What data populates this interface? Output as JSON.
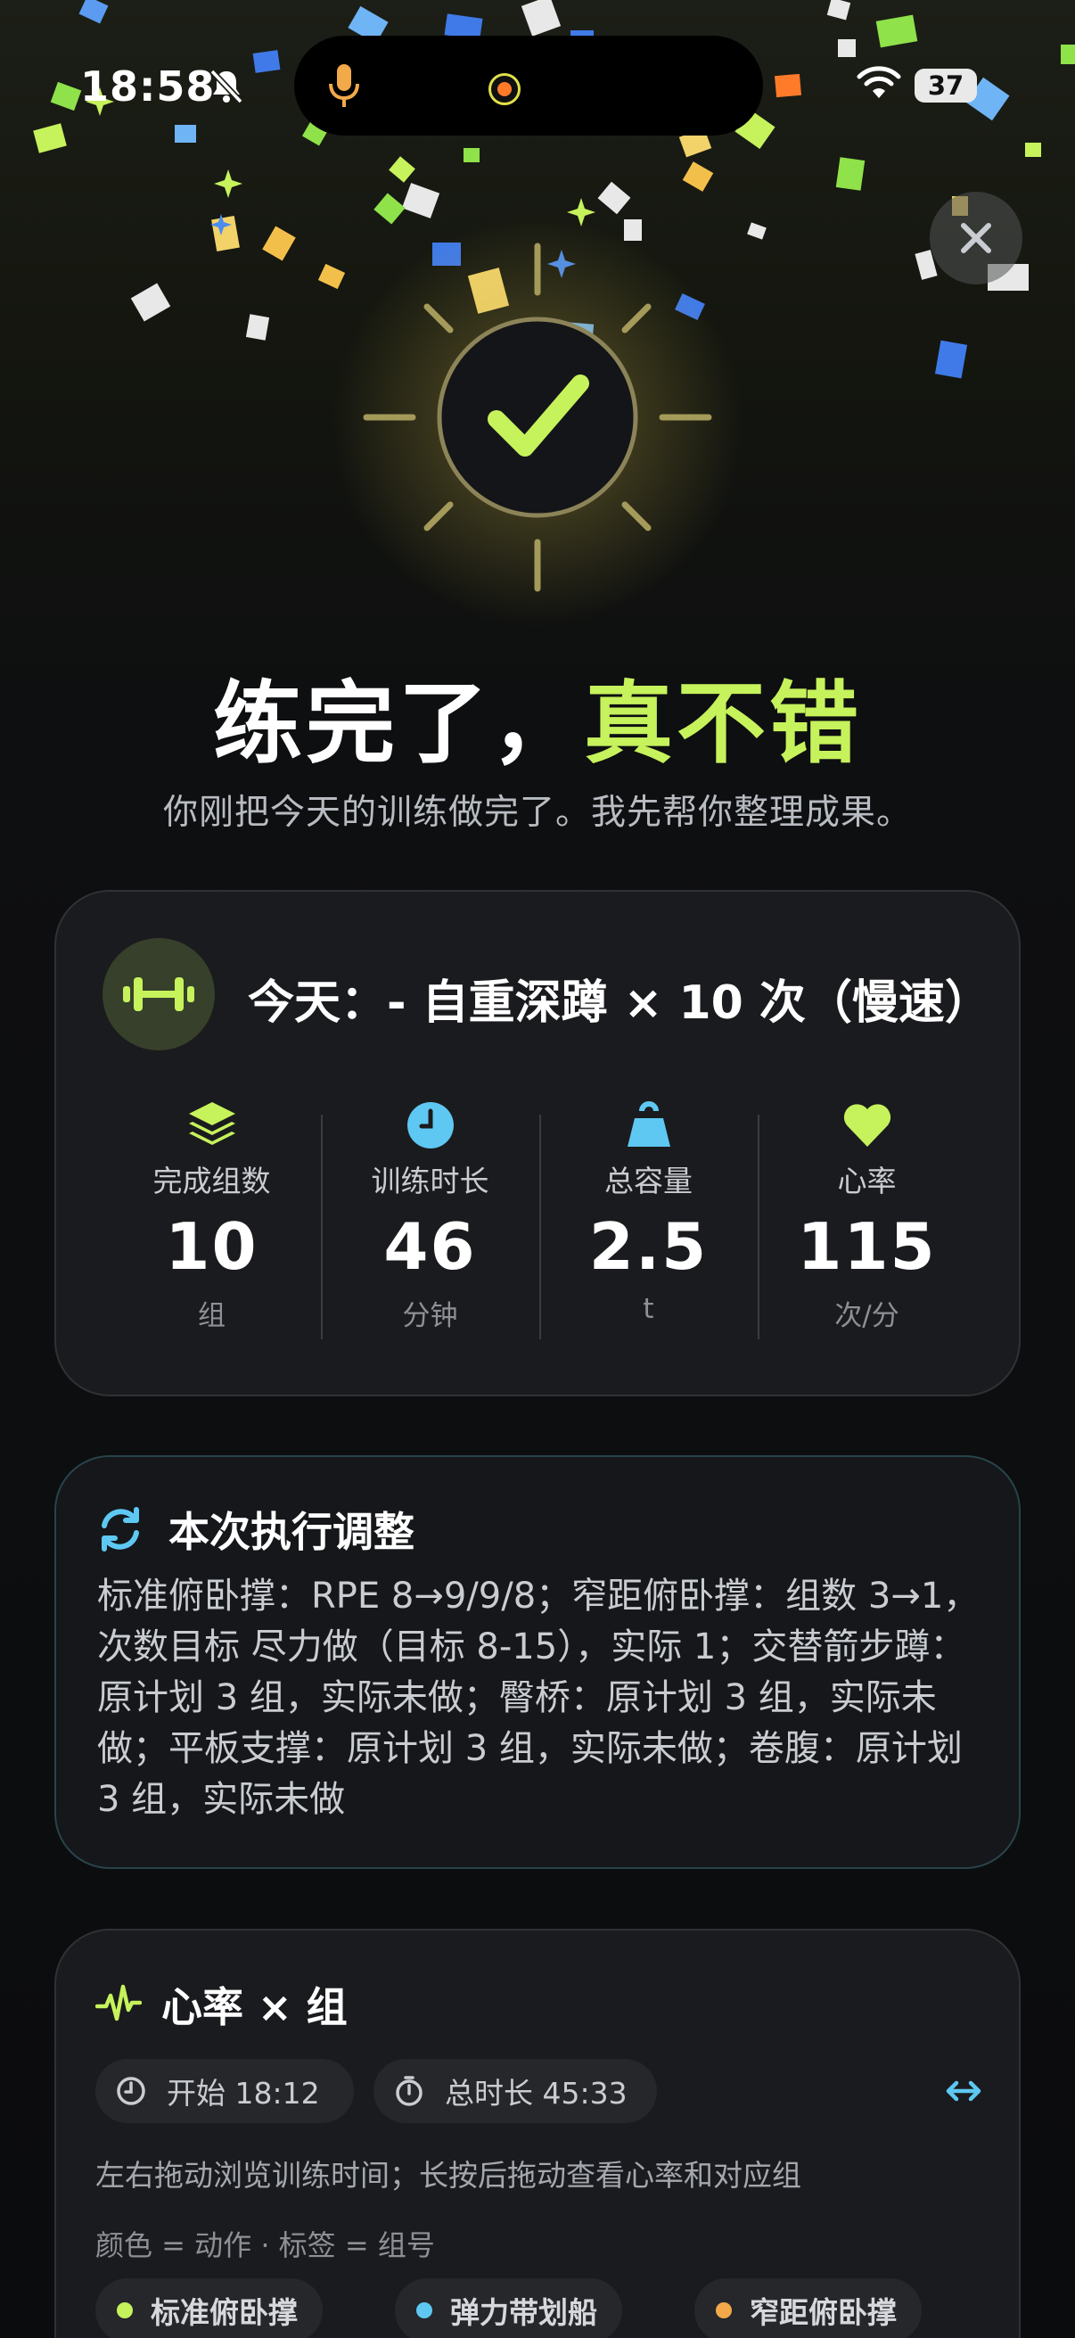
{
  "status_bar": {
    "time": "18:58",
    "battery": "37"
  },
  "hero": {
    "headline_main": "练完了，",
    "headline_accent": "真不错",
    "subline": "你刚把今天的训练做完了。我先帮你整理成果。"
  },
  "today_card": {
    "title": "今天：- 自重深蹲 × 10 次（慢速）",
    "stats": [
      {
        "icon": "layers-icon",
        "label": "完成组数",
        "value": "10",
        "unit": "组"
      },
      {
        "icon": "clock-icon",
        "label": "训练时长",
        "value": "46",
        "unit": "分钟"
      },
      {
        "icon": "kettlebell-icon",
        "label": "总容量",
        "value": "2.5",
        "unit": "t"
      },
      {
        "icon": "heart-icon",
        "label": "心率",
        "value": "115",
        "unit": "次/分"
      }
    ]
  },
  "adjust_card": {
    "title": "本次执行调整",
    "body": "标准俯卧撑：RPE 8→9/9/8；窄距俯卧撑：组数 3→1，次数目标 尽力做（目标 8-15），实际 1；交替箭步蹲：原计划 3 组，实际未做；臀桥：原计划 3 组，实际未做；平板支撑：原计划 3 组，实际未做；卷腹：原计划 3 组，实际未做"
  },
  "hr_card": {
    "title": "心率 × 组",
    "start_chip": "开始 18:12",
    "duration_chip": "总时长 45:33",
    "hint": "左右拖动浏览训练时间；长按后拖动查看心率和对应组",
    "legend_note": "颜色 = 动作 · 标签 = 组号",
    "legend": [
      {
        "label": "标准俯卧撑",
        "color": "#c6f25c"
      },
      {
        "label": "弹力带划船",
        "color": "#5ec8f2"
      },
      {
        "label": "窄距俯卧撑",
        "color": "#f2a94a"
      }
    ]
  },
  "colors": {
    "accent": "#c6f25c",
    "cyan": "#5ec8f2",
    "background": "#0b0c0e"
  }
}
